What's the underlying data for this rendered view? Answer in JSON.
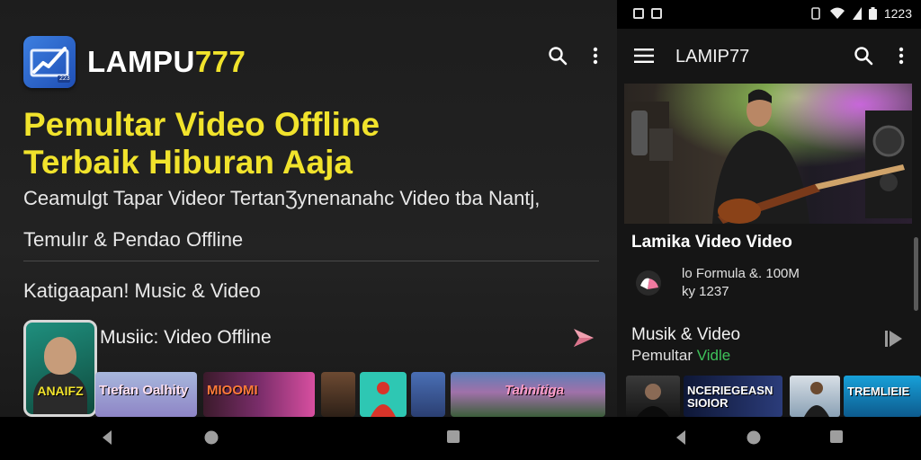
{
  "left": {
    "app_name_white": "LAMPU",
    "app_name_accent": "777",
    "logo_badge": "223",
    "headline_line1": "Pemultar Video Offline",
    "headline_line2": "Terbaik Hiburan Aaja",
    "subline1": "Ceamulgt Tapar Videor TertanƷynenanahc Video tba Nantj,",
    "subline2": "Temulır & Pendao Offline",
    "category": "Katigaapan! Music & Video",
    "phone_thumb_label": "ANAIFZ",
    "row_title": "Musiic: Video Offline",
    "thumbs": [
      {
        "caption": "Tıefan Oalhity"
      },
      {
        "caption": "MIOOMI"
      },
      {
        "caption": ""
      },
      {
        "caption": ""
      },
      {
        "caption": ""
      },
      {
        "caption": "Tahnitiga"
      }
    ]
  },
  "status": {
    "time": "1223"
  },
  "right": {
    "title": "LAMIP77",
    "video_title": "Lamika Video Video",
    "meta_line1": "lo Formula &. 100M",
    "meta_line2": "ky 1237",
    "section_title": "Musik & Video",
    "section_sub_prefix": "Pemultar ",
    "section_sub_green": "Vidle",
    "thumbs": [
      {
        "caption": ""
      },
      {
        "caption": "NCERIEGEASN SIOIOR"
      },
      {
        "caption": ""
      },
      {
        "caption": "TREMLIEIE"
      }
    ]
  },
  "colors": {
    "accent_yellow": "#f1e32c",
    "green": "#3ec25a",
    "arrow_pink": "#f0a0b0"
  },
  "icons": [
    "search-icon",
    "more-vert-icon",
    "menu-icon",
    "send-icon",
    "play-icon",
    "wifi-icon",
    "battery-icon",
    "back-icon",
    "home-icon",
    "recents-icon"
  ]
}
